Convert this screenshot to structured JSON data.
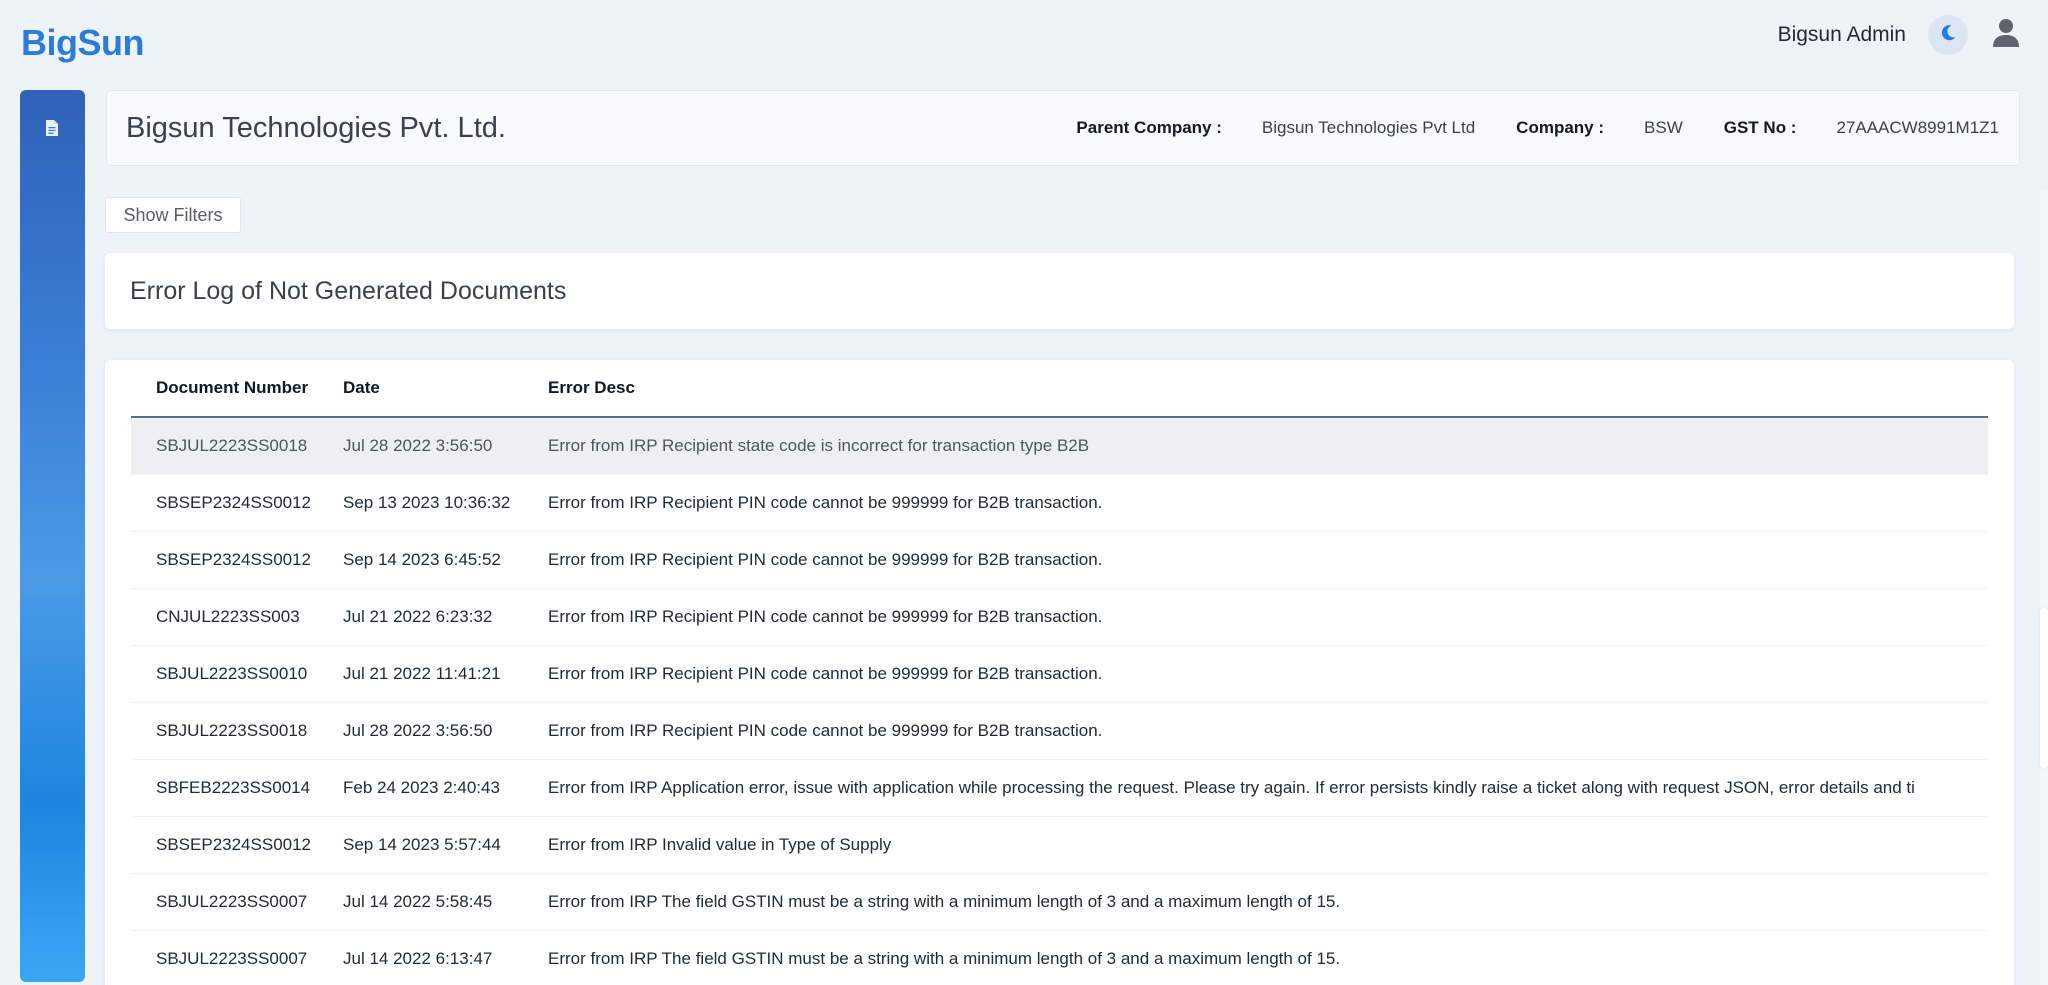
{
  "app": {
    "logo": "BigSun"
  },
  "header": {
    "user_name": "Bigsun Admin",
    "theme_icon": "moon-icon",
    "profile_icon": "user-icon"
  },
  "sidebar": {
    "items": [
      {
        "icon": "document-icon"
      }
    ]
  },
  "company": {
    "name": "Bigsun Technologies Pvt. Ltd.",
    "parent_label": "Parent Company :",
    "parent_value": "Bigsun Technologies Pvt Ltd",
    "company_label": "Company :",
    "company_value": "BSW",
    "gst_label": "GST No :",
    "gst_value": "27AAACW8991M1Z1"
  },
  "filters": {
    "toggle_label": "Show Filters"
  },
  "section": {
    "title": "Error Log of Not Generated Documents"
  },
  "table": {
    "headers": [
      "Document Number",
      "Date",
      "Error Desc"
    ],
    "rows": [
      [
        "SBJUL2223SS0018",
        "Jul 28 2022 3:56:50",
        "Error from IRP Recipient state code is incorrect for transaction type B2B"
      ],
      [
        "SBSEP2324SS0012",
        "Sep 13 2023 10:36:32",
        "Error from IRP Recipient PIN code cannot be 999999 for B2B transaction."
      ],
      [
        "SBSEP2324SS0012",
        "Sep 14 2023 6:45:52",
        "Error from IRP Recipient PIN code cannot be 999999 for B2B transaction."
      ],
      [
        "CNJUL2223SS003",
        "Jul 21 2022 6:23:32",
        "Error from IRP Recipient PIN code cannot be 999999 for B2B transaction."
      ],
      [
        "SBJUL2223SS0010",
        "Jul 21 2022 11:41:21",
        "Error from IRP Recipient PIN code cannot be 999999 for B2B transaction."
      ],
      [
        "SBJUL2223SS0018",
        "Jul 28 2022 3:56:50",
        "Error from IRP Recipient PIN code cannot be 999999 for B2B transaction."
      ],
      [
        "SBFEB2223SS0014",
        "Feb 24 2023 2:40:43",
        "Error from IRP Application error, issue with application while processing the request. Please try again. If error persists kindly raise a ticket along with request JSON, error details and ti"
      ],
      [
        "SBSEP2324SS0012",
        "Sep 14 2023 5:57:44",
        "Error from IRP Invalid value in Type of Supply"
      ],
      [
        "SBJUL2223SS0007",
        "Jul 14 2022 5:58:45",
        "Error from IRP The field GSTIN must be a string with a minimum length of 3 and a maximum length of 15."
      ],
      [
        "SBJUL2223SS0007",
        "Jul 14 2022 6:13:47",
        "Error from IRP The field GSTIN must be a string with a minimum length of 3 and a maximum length of 15."
      ]
    ]
  },
  "colors": {
    "brand": "#2b7bdc",
    "background": "#eef2f9",
    "highlight_row": "#efeff1"
  }
}
